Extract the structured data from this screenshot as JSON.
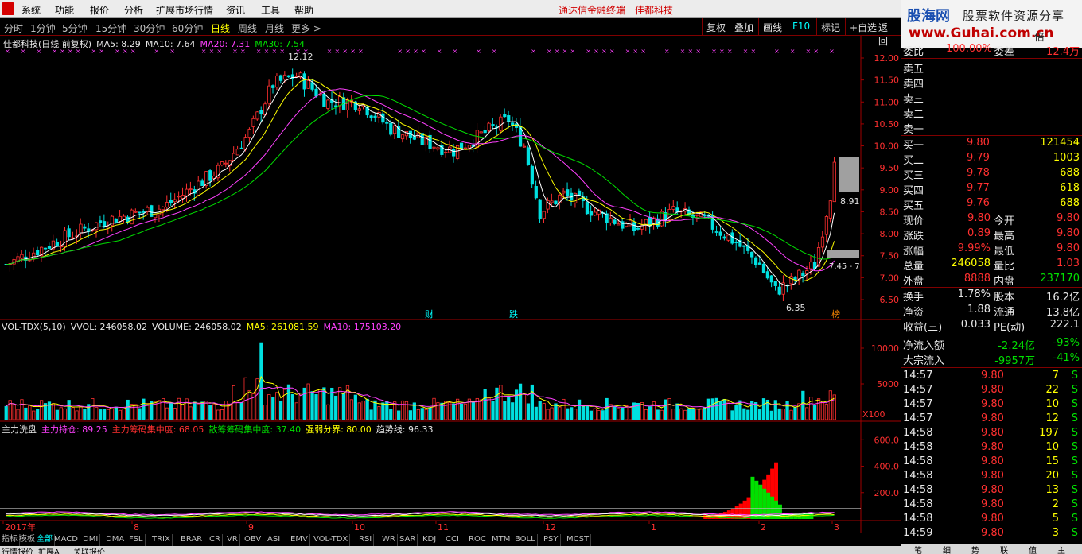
{
  "menu": {
    "items": [
      "系统",
      "功能",
      "报价",
      "分析",
      "扩展市场行情",
      "资讯",
      "工具",
      "帮助"
    ],
    "center_text": [
      "通达信金融终端",
      "佳都科技"
    ]
  },
  "watermark": {
    "line1": "股海网",
    "line2": "股票软件资源分享",
    "line3": "www.Guhai.com.cn",
    "line4": "倍"
  },
  "toolbar": {
    "periods": [
      "分时",
      "1分钟",
      "5分钟",
      "15分钟",
      "30分钟",
      "60分钟",
      "日线",
      "周线",
      "月线",
      "更多 >"
    ],
    "active_period": "日线",
    "right_buttons": [
      "复权",
      "叠加",
      "画线",
      "F10",
      "标记",
      "+自选",
      "返回"
    ]
  },
  "kline_header": {
    "title": "佳都科技(日线 前复权)",
    "ma5": "MA5: 8.29",
    "ma10": "MA10: 7.64",
    "ma20": "MA20: 7.31",
    "ma30": "MA30: 7.54"
  },
  "price_axis": [
    "12.00",
    "11.50",
    "11.00",
    "10.50",
    "10.00",
    "9.50",
    "9.00",
    "8.50",
    "8.00",
    "7.50",
    "7.00",
    "6.50"
  ],
  "annotations": {
    "high": "12.12",
    "low": "6.35",
    "last": "8.91",
    "right_label": "7.45 - 7",
    "marks": [
      "财",
      "跌",
      "榜"
    ]
  },
  "vol_header": {
    "title": "VOL-TDX(5,10)",
    "vvol": "VVOL: 246058.02",
    "volume": "VOLUME: 246058.02",
    "ma5": "MA5: 261081.59",
    "ma10": "MA10: 175103.20"
  },
  "vol_axis": [
    "10000",
    "5000"
  ],
  "vol_unit": "X100",
  "ind_header": {
    "title": "主力洗盘",
    "a": "主力持仓: 89.25",
    "b": "主力筹码集中度: 68.05",
    "c": "散筹筹码集中度: 37.40",
    "d": "强弱分界: 80.00",
    "e": "趋势线: 96.33"
  },
  "ind_axis": [
    "600.0",
    "400.0",
    "200.0"
  ],
  "date_axis": [
    "2017年",
    "8",
    "9",
    "10",
    "11",
    "12",
    "1",
    "2",
    "3"
  ],
  "bottom_tabs": [
    "指标",
    "模板",
    "全部",
    "MACD",
    "DMI",
    "DMA",
    "FSL",
    "TRIX",
    "BRAR",
    "CR",
    "VR",
    "OBV",
    "ASI",
    "EMV",
    "VOL-TDX",
    "RSI",
    "WR",
    "SAR",
    "KDJ",
    "CCI",
    "ROC",
    "MTM",
    "BOLL",
    "PSY",
    "MCST"
  ],
  "active_tab": "全部",
  "status_items": [
    "行情报价",
    "扩展A",
    "关联报价"
  ],
  "right": {
    "weibi": {
      "label": "委比",
      "value": "100.00%",
      "label2": "委差",
      "value2": "12.4万"
    },
    "sells": [
      {
        "label": "卖五"
      },
      {
        "label": "卖四"
      },
      {
        "label": "卖三"
      },
      {
        "label": "卖二"
      },
      {
        "label": "卖一"
      }
    ],
    "buys": [
      {
        "label": "买一",
        "price": "9.80",
        "vol": "121454"
      },
      {
        "label": "买二",
        "price": "9.79",
        "vol": "1003"
      },
      {
        "label": "买三",
        "price": "9.78",
        "vol": "688"
      },
      {
        "label": "买四",
        "price": "9.77",
        "vol": "618"
      },
      {
        "label": "买五",
        "price": "9.76",
        "vol": "688"
      }
    ],
    "quote": [
      {
        "l1": "现价",
        "v1": "9.80",
        "l2": "今开",
        "v2": "9.80"
      },
      {
        "l1": "涨跌",
        "v1": "0.89",
        "l2": "最高",
        "v2": "9.80"
      },
      {
        "l1": "涨幅",
        "v1": "9.99%",
        "l2": "最低",
        "v2": "9.80"
      },
      {
        "l1": "总量",
        "v1": "246058",
        "l2": "量比",
        "v2": "1.03"
      },
      {
        "l1": "外盘",
        "v1": "8888",
        "l2": "内盘",
        "v2": "237170"
      }
    ],
    "fin": [
      {
        "l1": "换手",
        "v1": "1.78%",
        "l2": "股本",
        "v2": "16.2亿"
      },
      {
        "l1": "净资",
        "v1": "1.88",
        "l2": "流通",
        "v2": "13.8亿"
      },
      {
        "l1": "收益(三)",
        "v1": "0.033",
        "l2": "PE(动)",
        "v2": "222.1"
      }
    ],
    "flow": [
      {
        "label": "净流入额",
        "value": "-2.24亿",
        "pct": "-93%"
      },
      {
        "label": "大宗流入",
        "value": "-9957万",
        "pct": "-41%"
      }
    ],
    "ticks": [
      {
        "t": "14:57",
        "p": "9.80",
        "v": "7",
        "s": "S"
      },
      {
        "t": "14:57",
        "p": "9.80",
        "v": "22",
        "s": "S"
      },
      {
        "t": "14:57",
        "p": "9.80",
        "v": "10",
        "s": "S"
      },
      {
        "t": "14:57",
        "p": "9.80",
        "v": "12",
        "s": "S"
      },
      {
        "t": "14:58",
        "p": "9.80",
        "v": "197",
        "s": "S"
      },
      {
        "t": "14:58",
        "p": "9.80",
        "v": "10",
        "s": "S"
      },
      {
        "t": "14:58",
        "p": "9.80",
        "v": "15",
        "s": "S"
      },
      {
        "t": "14:58",
        "p": "9.80",
        "v": "20",
        "s": "S"
      },
      {
        "t": "14:58",
        "p": "9.80",
        "v": "13",
        "s": "S"
      },
      {
        "t": "14:58",
        "p": "9.80",
        "v": "2",
        "s": "S"
      },
      {
        "t": "14:58",
        "p": "9.80",
        "v": "5",
        "s": "S"
      },
      {
        "t": "14:59",
        "p": "9.80",
        "v": "3",
        "s": "S"
      }
    ],
    "bottom_tabs": [
      "笔",
      "细",
      "势",
      "联",
      "值",
      "主"
    ]
  }
}
